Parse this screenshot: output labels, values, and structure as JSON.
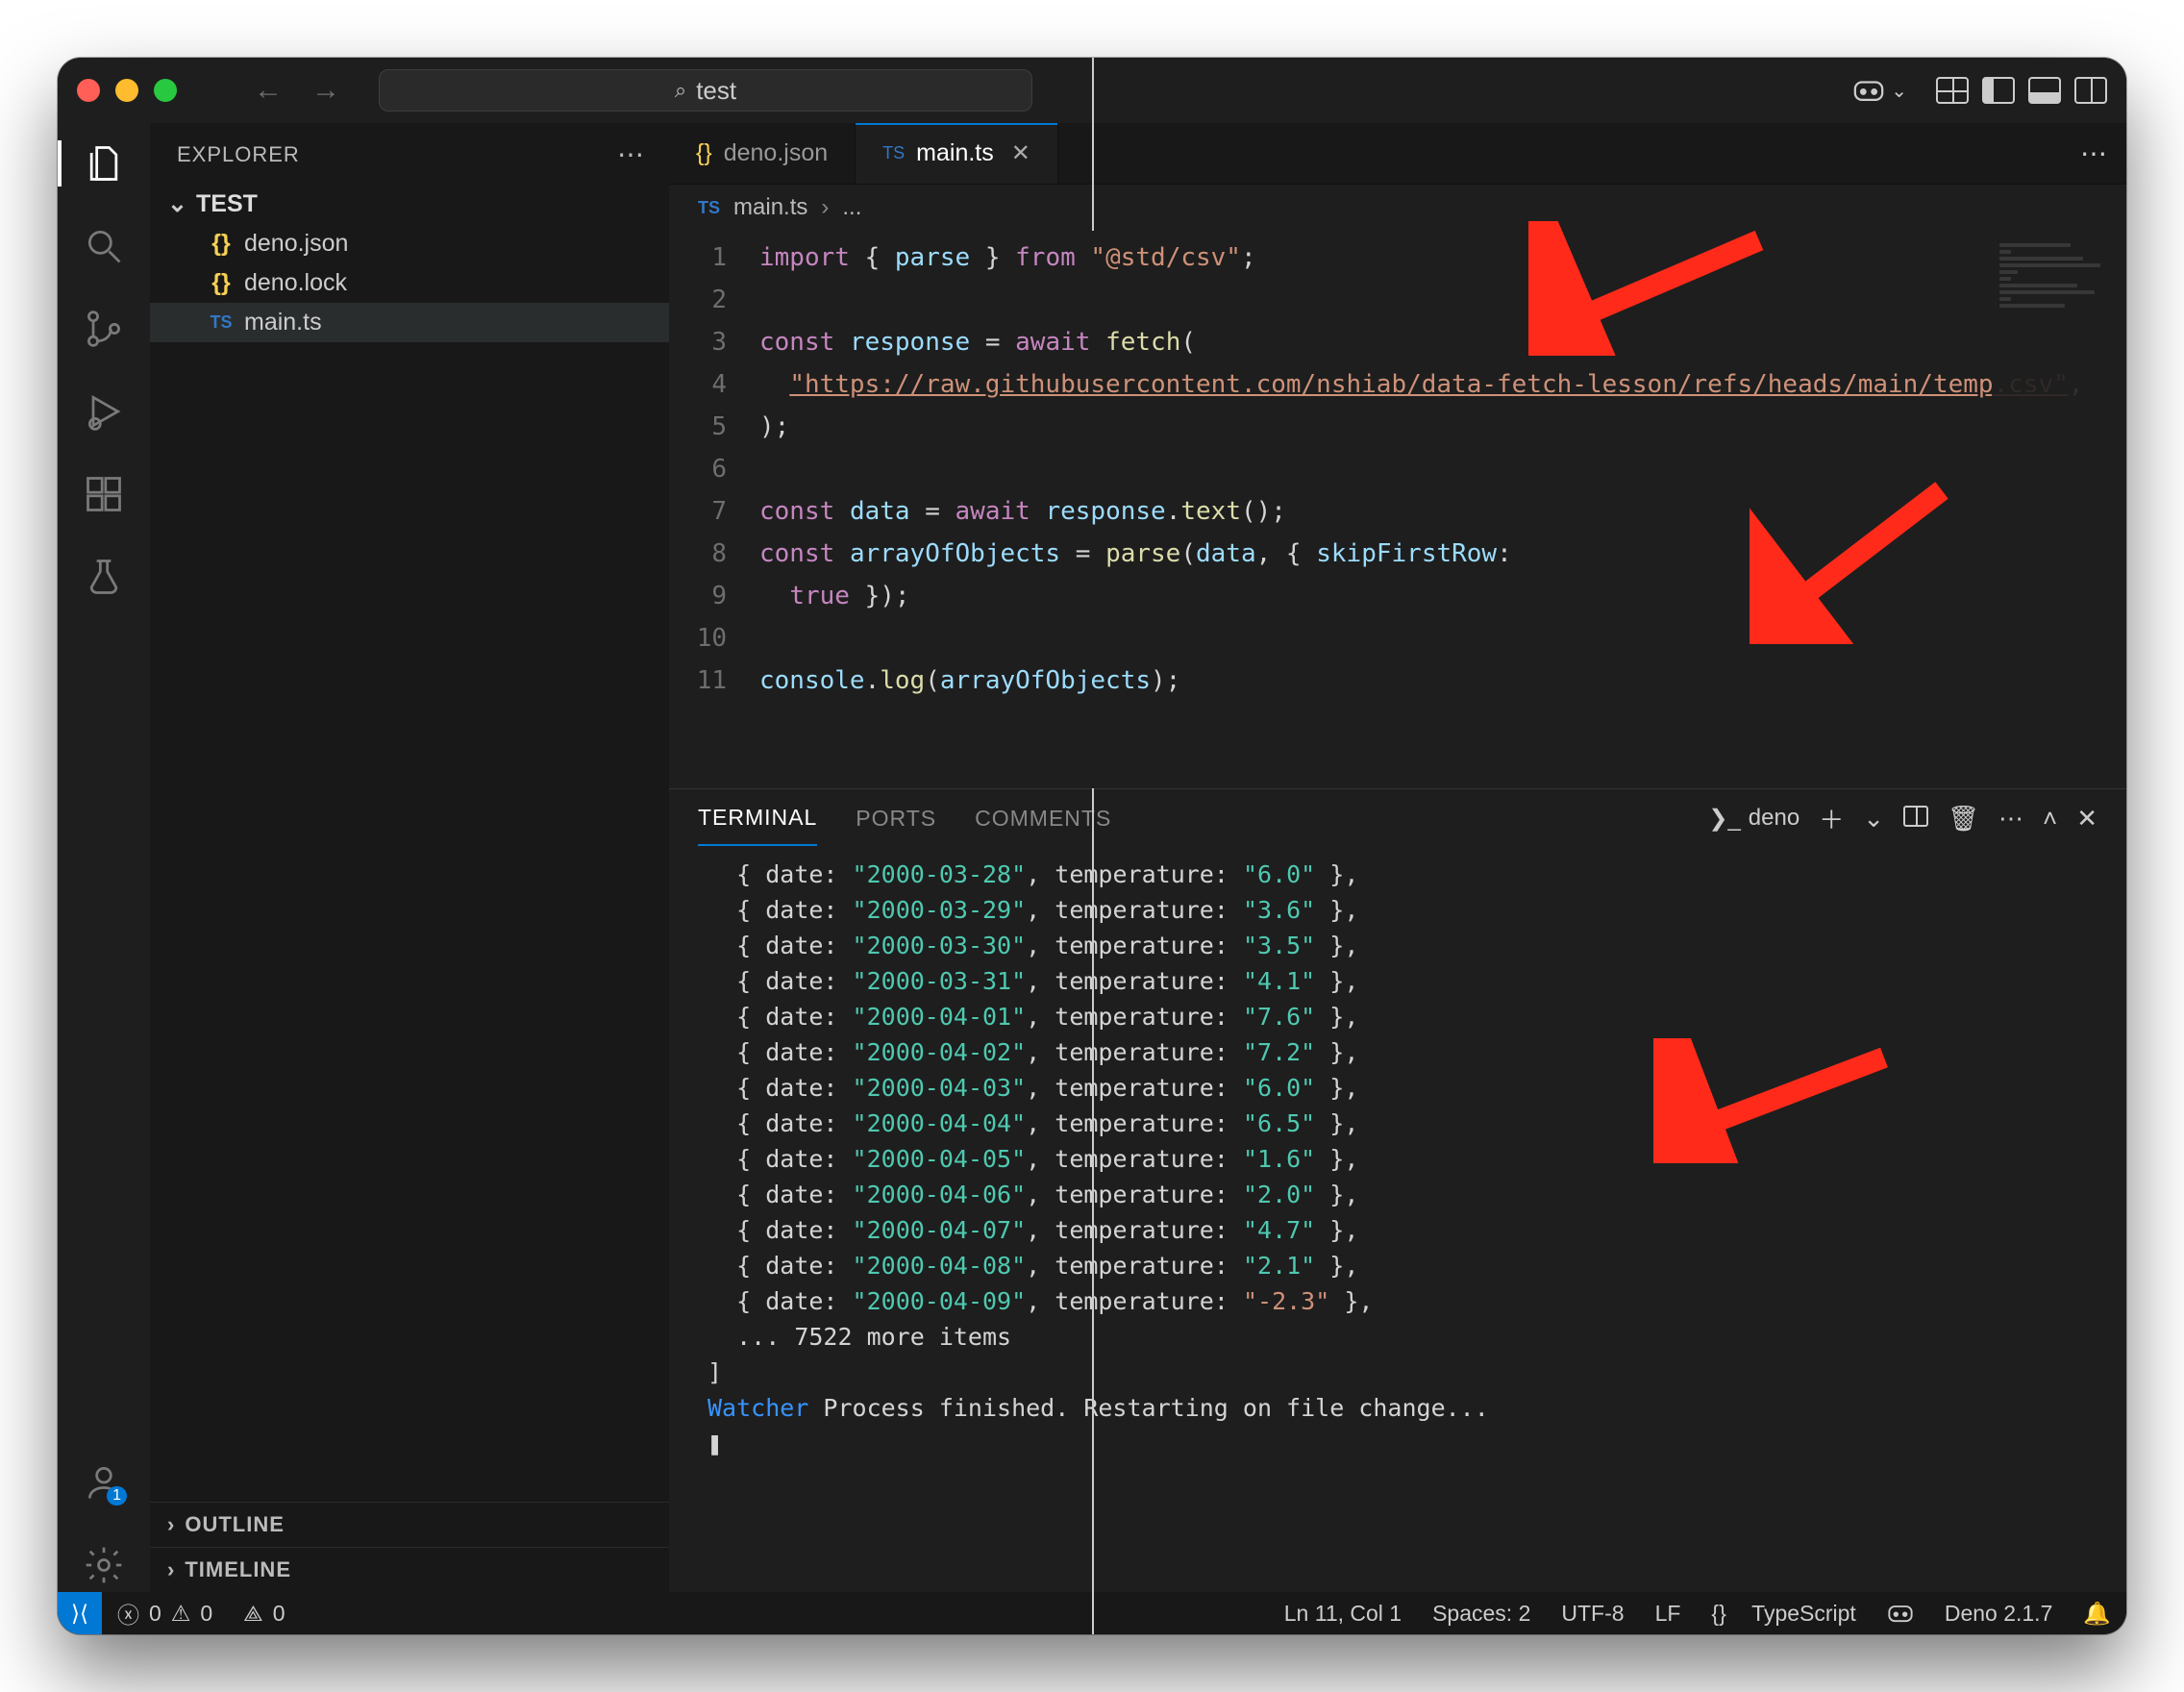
{
  "titlebar": {
    "search_text": "test"
  },
  "sidebar": {
    "title": "EXPLORER",
    "root_folder": "TEST",
    "files": [
      {
        "icon": "{}",
        "iconClass": "json",
        "name": "deno.json"
      },
      {
        "icon": "{}",
        "iconClass": "json",
        "name": "deno.lock"
      },
      {
        "icon": "TS",
        "iconClass": "ts",
        "name": "main.ts",
        "selected": true
      }
    ],
    "outline": "OUTLINE",
    "timeline": "TIMELINE"
  },
  "tabs": [
    {
      "icon": "{}",
      "iconClass": "json",
      "label": "deno.json",
      "active": false
    },
    {
      "icon": "TS",
      "iconClass": "ts",
      "label": "main.ts",
      "active": true,
      "close": true
    }
  ],
  "breadcrumb": {
    "icon": "TS",
    "file": "main.ts",
    "rest": "..."
  },
  "code": {
    "lines": [
      "1",
      "2",
      "3",
      "4",
      "5",
      "6",
      "7",
      "8",
      "9",
      "10",
      "11"
    ]
  },
  "panel": {
    "tabs": {
      "terminal": "TERMINAL",
      "ports": "PORTS",
      "comments": "COMMENTS"
    },
    "terminal_name": "deno"
  },
  "terminal_output": {
    "rows": [
      {
        "date": "2000-03-28",
        "temperature": "6.0"
      },
      {
        "date": "2000-03-29",
        "temperature": "3.6"
      },
      {
        "date": "2000-03-30",
        "temperature": "3.5"
      },
      {
        "date": "2000-03-31",
        "temperature": "4.1"
      },
      {
        "date": "2000-04-01",
        "temperature": "7.6"
      },
      {
        "date": "2000-04-02",
        "temperature": "7.2"
      },
      {
        "date": "2000-04-03",
        "temperature": "6.0"
      },
      {
        "date": "2000-04-04",
        "temperature": "6.5"
      },
      {
        "date": "2000-04-05",
        "temperature": "1.6"
      },
      {
        "date": "2000-04-06",
        "temperature": "2.0"
      },
      {
        "date": "2000-04-07",
        "temperature": "4.7"
      },
      {
        "date": "2000-04-08",
        "temperature": "2.1"
      },
      {
        "date": "2000-04-09",
        "temperature": "-2.3"
      }
    ],
    "more_items": "... 7522 more items",
    "watcher_line": "Process finished. Restarting on file change...",
    "watcher_label": "Watcher",
    "prompt": "❚"
  },
  "statusbar": {
    "remote_icon": "⎓",
    "errors": "0",
    "warnings": "0",
    "radio": "0",
    "position": "Ln 11, Col 1",
    "spaces": "Spaces: 2",
    "encoding": "UTF-8",
    "eol": "LF",
    "lang_icon": "{}",
    "language": "TypeScript",
    "deno": "Deno 2.1.7"
  },
  "code_tokens": {
    "l1": {
      "import": "import",
      "lb": "{",
      "parse": "parse",
      "rb": "}",
      "from": "from",
      "pkg": "\"@std/csv\""
    },
    "l3": {
      "const": "const",
      "response": "response",
      "eq": "=",
      "await": "await",
      "fetch": "fetch"
    },
    "l4": {
      "url": "\"https://raw.githubusercontent.com/nshiab/data-fetch-lesson/refs/heads/main/temp.csv\""
    },
    "l7": {
      "const": "const",
      "data": "data",
      "await": "await",
      "response": "response",
      "text": "text"
    },
    "l8": {
      "const": "const",
      "arr": "arrayOfObjects",
      "parse": "parse",
      "data": "data",
      "skip": "skipFirstRow",
      "true": "true"
    },
    "l10": {
      "console": "console",
      "log": "log",
      "arr": "arrayOfObjects"
    }
  }
}
